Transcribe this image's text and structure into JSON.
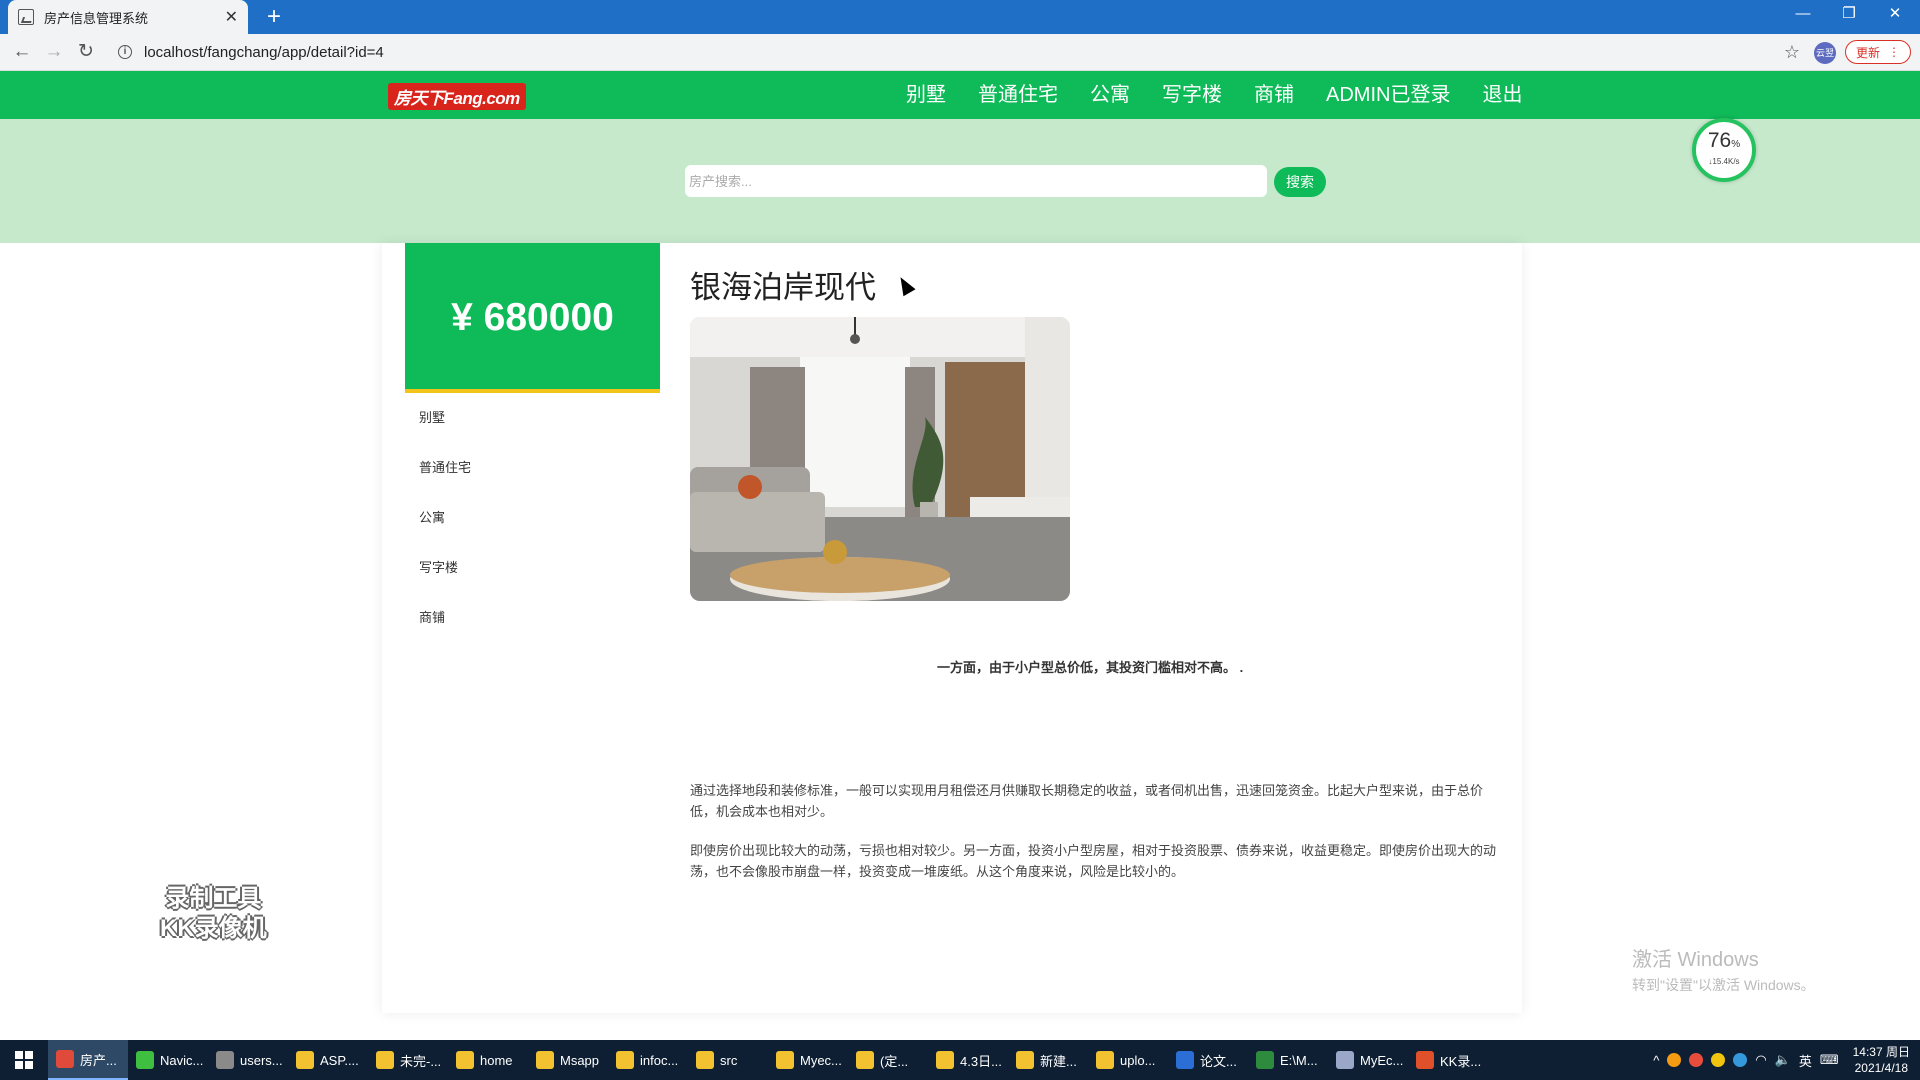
{
  "browser": {
    "tab_title": "房产信息管理系统",
    "new_tab": "+",
    "url": "localhost/fangchang/app/detail?id=4",
    "update_label": "更新",
    "profile_label": "云翌"
  },
  "site": {
    "logo_text": "房天下Fang.com",
    "menu": [
      "别墅",
      "普通住宅",
      "公寓",
      "写字楼",
      "商铺",
      "ADMIN已登录",
      "退出"
    ],
    "search_placeholder": "房产搜索...",
    "search_button": "搜索"
  },
  "net_meter": {
    "percent": "76",
    "speed": "↓15.4K/s"
  },
  "detail": {
    "price": "¥ 680000",
    "title": "银海泊岸现代",
    "side_menu": [
      "别墅",
      "普通住宅",
      "公寓",
      "写字楼",
      "商铺"
    ],
    "lead": "一方面，由于小户型总价低，其投资门槛相对不高。 .",
    "para1": "通过选择地段和装修标准，一般可以实现用月租偿还月供赚取长期稳定的收益，或者伺机出售，迅速回笼资金。比起大户型来说，由于总价低，机会成本也相对少。",
    "para2": "即使房价出现比较大的动荡，亏损也相对较少。另一方面，投资小户型房屋，相对于投资股票、债券来说，收益更稳定。即使房价出现大的动荡，也不会像股市崩盘一样，投资变成一堆废纸。从这个角度来说，风险是比较小的。"
  },
  "watermarks": {
    "recorder_line1": "录制工具",
    "recorder_line2": "KK录像机",
    "windows_line1": "激活 Windows",
    "windows_line2": "转到\"设置\"以激活 Windows。"
  },
  "taskbar": {
    "apps": [
      {
        "label": "房产...",
        "color": "#e04a3a"
      },
      {
        "label": "Navic...",
        "color": "#3fbf3f"
      },
      {
        "label": "users...",
        "color": "#8a8a8a"
      },
      {
        "label": "ASP....",
        "color": "#f2c230"
      },
      {
        "label": "未完-...",
        "color": "#f2c230"
      },
      {
        "label": "home",
        "color": "#f2c230"
      },
      {
        "label": "Msapp",
        "color": "#f2c230"
      },
      {
        "label": "infoc...",
        "color": "#f2c230"
      },
      {
        "label": "src",
        "color": "#f2c230"
      },
      {
        "label": "Myec...",
        "color": "#f2c230"
      },
      {
        "label": "(定...",
        "color": "#f2c230"
      },
      {
        "label": "4.3日...",
        "color": "#f2c230"
      },
      {
        "label": "新建...",
        "color": "#f2c230"
      },
      {
        "label": "uplo...",
        "color": "#f2c230"
      },
      {
        "label": "论文...",
        "color": "#2b6fd6"
      },
      {
        "label": "E:\\M...",
        "color": "#2e8b3e"
      },
      {
        "label": "MyEc...",
        "color": "#9aa7c9"
      },
      {
        "label": "KK录...",
        "color": "#e0502a"
      }
    ],
    "ime": "英",
    "time": "14:37 周日",
    "date": "2021/4/18"
  },
  "colors": {
    "brand_green": "#0fba59",
    "search_band": "#c6e9cc",
    "price_underline": "#f0c419"
  }
}
